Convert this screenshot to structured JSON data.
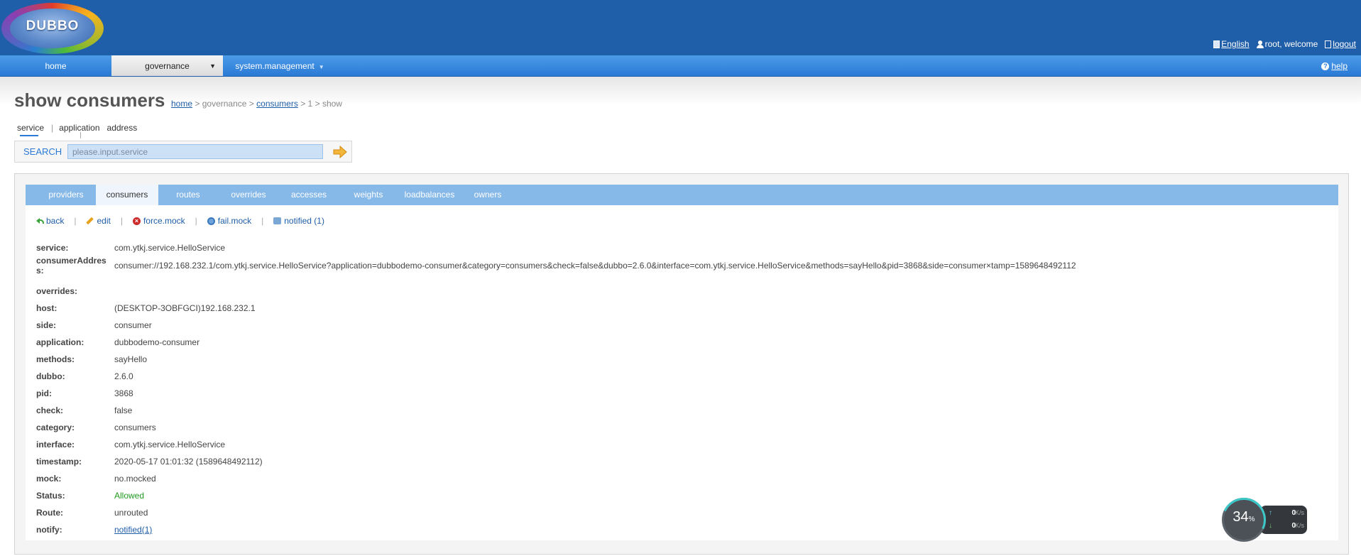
{
  "logo": {
    "text": "DUBBO"
  },
  "user_bar": {
    "language": "English",
    "welcome": "root, welcome",
    "logout": "logout"
  },
  "nav": {
    "home": "home",
    "governance": "governance",
    "system_management": "system.management",
    "help": "help"
  },
  "page": {
    "title": "show consumers",
    "breadcrumb": {
      "home": "home",
      "sep1": ">",
      "governance": "governance",
      "sep2": ">",
      "consumers": "consumers",
      "sep3": ">",
      "id": "1",
      "sep4": ">",
      "show": "show"
    }
  },
  "search": {
    "tabs": [
      "service",
      "application",
      "address"
    ],
    "tab_separator": "|",
    "label": "SEARCH",
    "placeholder": "please.input.service"
  },
  "tabs": [
    "providers",
    "consumers",
    "routes",
    "overrides",
    "accesses",
    "weights",
    "loadbalances",
    "owners"
  ],
  "active_tab": "consumers",
  "actions": {
    "back": "back",
    "edit": "edit",
    "force_mock": "force.mock",
    "fail_mock": "fail.mock",
    "notified": "notified (1)",
    "separator": "|"
  },
  "details": [
    {
      "key": "service:",
      "value": "com.ytkj.service.HelloService"
    },
    {
      "key": "consumerAddress:",
      "value": "consumer://192.168.232.1/com.ytkj.service.HelloService?application=dubbodemo-consumer&category=consumers&check=false&dubbo=2.6.0&interface=com.ytkj.service.HelloService&methods=sayHello&pid=3868&side=consumer×tamp=1589648492112"
    },
    {
      "key": "overrides:",
      "value": ""
    },
    {
      "key": "host:",
      "value": "(DESKTOP-3OBFGCI)192.168.232.1"
    },
    {
      "key": "side:",
      "value": "consumer"
    },
    {
      "key": "application:",
      "value": "dubbodemo-consumer"
    },
    {
      "key": "methods:",
      "value": "sayHello"
    },
    {
      "key": "dubbo:",
      "value": "2.6.0"
    },
    {
      "key": "pid:",
      "value": "3868"
    },
    {
      "key": "check:",
      "value": "false"
    },
    {
      "key": "category:",
      "value": "consumers"
    },
    {
      "key": "interface:",
      "value": "com.ytkj.service.HelloService"
    },
    {
      "key": "timestamp:",
      "value": "2020-05-17 01:01:32 (1589648492112)"
    },
    {
      "key": "mock:",
      "value": "no.mocked"
    },
    {
      "key": "Status:",
      "value": "Allowed"
    },
    {
      "key": "Route:",
      "value": "unrouted"
    },
    {
      "key": "notify:",
      "value": "notified(1)"
    }
  ],
  "speed_widget": {
    "percent": "34",
    "percent_unit": "%",
    "upload": "0",
    "download": "0",
    "unit": "K/s"
  },
  "colors": {
    "header": "#1f5ea8",
    "nav": "#2a7ad6",
    "tabbar": "#86b8e8",
    "allowed": "#229922"
  }
}
